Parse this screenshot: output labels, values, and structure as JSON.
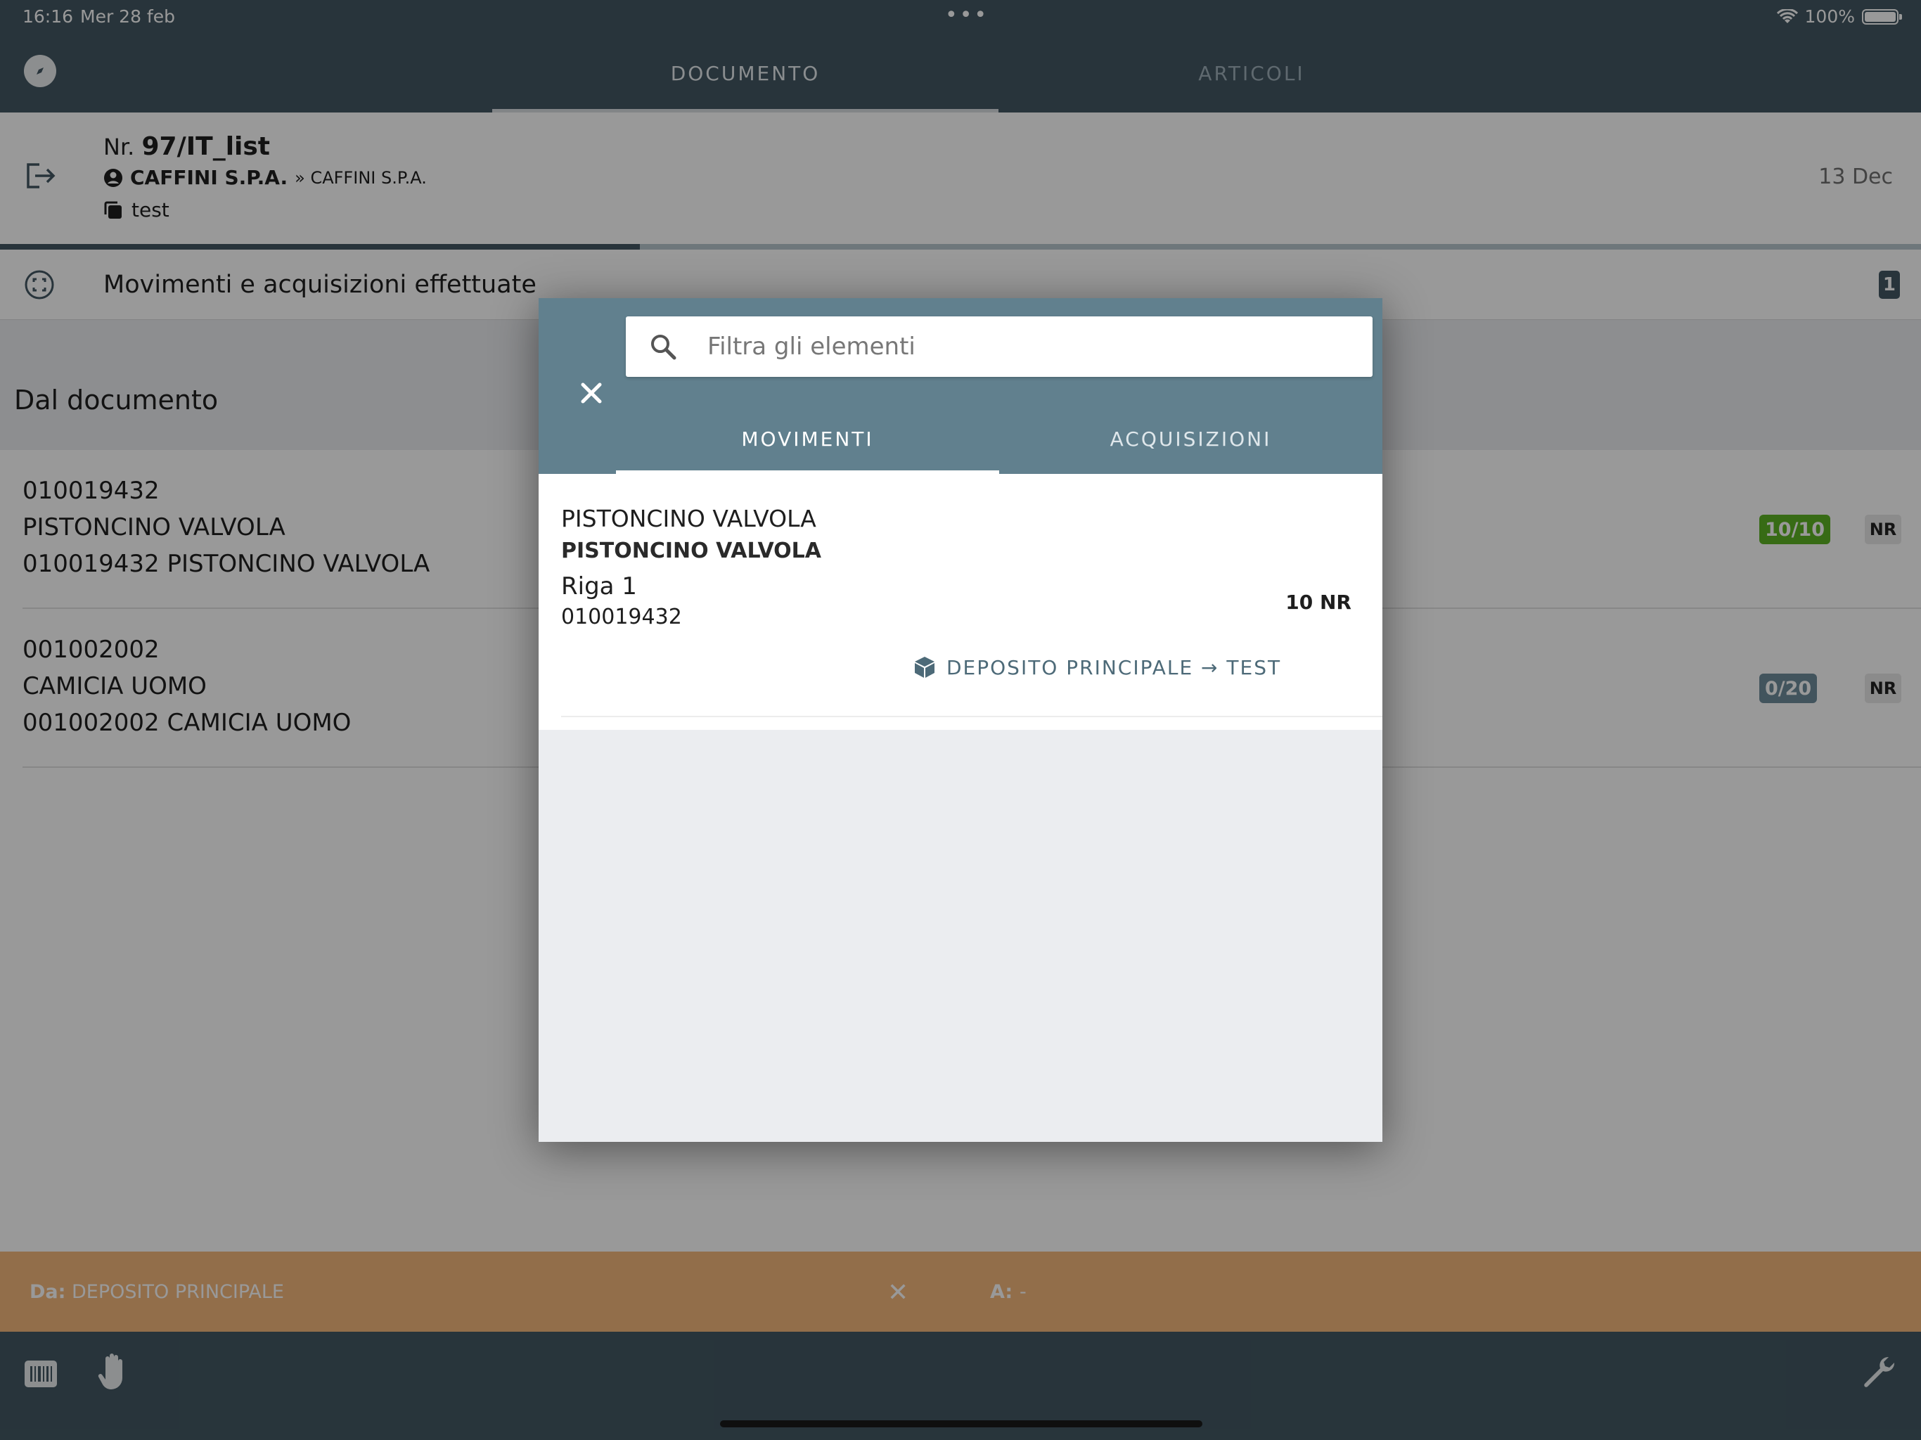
{
  "status": {
    "time": "16:16",
    "date": "Mer 28 feb",
    "battery": "100%"
  },
  "header": {
    "tabs": [
      "DOCUMENTO",
      "ARTICOLI"
    ]
  },
  "document": {
    "nr_prefix": "Nr.",
    "number": "97/IT_list",
    "customer": "CAFFINI S.P.A.",
    "customer_sub": "» CAFFINI S.P.A.",
    "description": "test",
    "date": "13 Dec",
    "progress": 0.333
  },
  "movements": {
    "label": "Movimenti e acquisizioni effettuate",
    "count": "1"
  },
  "section": {
    "title": "Dal documento"
  },
  "articles": [
    {
      "code": "010019432",
      "name": "PISTONCINO VALVOLA",
      "full": "010019432 PISTONCINO VALVOLA",
      "qty": "10/10",
      "unit": "NR",
      "qty_color": "#5cb323"
    },
    {
      "code": "001002002",
      "name": "CAMICIA UOMO",
      "full": "001002002 CAMICIA UOMO",
      "qty": "0/20",
      "unit": "NR",
      "qty_color": "#6e8d9c"
    }
  ],
  "from_bar": {
    "da_label": "Da:",
    "da_value": "DEPOSITO PRINCIPALE",
    "a_label": "A:",
    "a_value": "-"
  },
  "modal": {
    "search_placeholder": "Filtra gli elementi",
    "tabs": [
      "MOVIMENTI",
      "ACQUISIZIONI"
    ],
    "item": {
      "title": "PISTONCINO VALVOLA",
      "subtitle": "PISTONCINO VALVOLA",
      "row": "Riga 1",
      "code": "010019432",
      "qty": "10 NR",
      "route": "DEPOSITO PRINCIPALE → TEST"
    }
  },
  "icons": [
    "compass-icon",
    "exit-icon",
    "person-icon",
    "copy-icon",
    "scan-icon",
    "close-icon",
    "search-icon",
    "box-icon",
    "barcode-icon",
    "hand-icon",
    "wrench-icon"
  ],
  "colors": {
    "primary": "#435863",
    "modal_header": "#61808e",
    "orange": "#f4b77c",
    "green": "#5cb323"
  }
}
